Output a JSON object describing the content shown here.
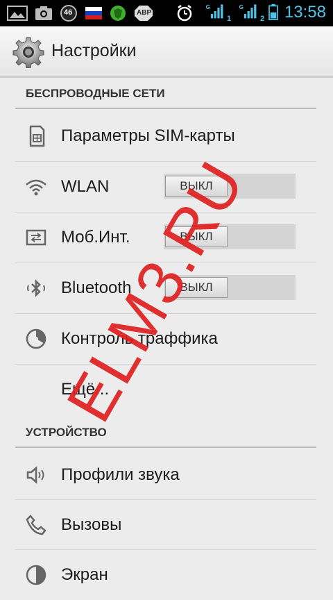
{
  "status_bar": {
    "time": "13:58",
    "network_badge": "46",
    "abp_badge": "ABP",
    "sim1_index": "1",
    "sim2_index": "2",
    "icons": [
      "gallery-icon",
      "camera-icon",
      "network-46-icon",
      "russian-flag-icon",
      "shield-app-icon",
      "abp-icon",
      "alarm-icon",
      "signal-sim1-icon",
      "signal-sim2-icon",
      "battery-icon"
    ]
  },
  "action_bar": {
    "title": "Настройки",
    "icon": "settings-gear-icon"
  },
  "sections": {
    "wireless": {
      "header": "БЕСПРОВОДНЫЕ СЕТИ",
      "items": [
        {
          "label": "Параметры SIM-карты",
          "icon": "sim-card-icon"
        },
        {
          "label": "WLAN",
          "icon": "wifi-icon",
          "toggle": "ВЫКЛ"
        },
        {
          "label": "Моб.Инт.",
          "icon": "data-transfer-icon",
          "toggle": "ВЫКЛ"
        },
        {
          "label": "Bluetooth",
          "icon": "bluetooth-icon",
          "toggle": "ВЫКЛ"
        },
        {
          "label": "Контроль траффика",
          "icon": "data-usage-icon"
        },
        {
          "label": "Ещё..."
        }
      ]
    },
    "device": {
      "header": "УСТРОЙСТВО",
      "items": [
        {
          "label": "Профили звука",
          "icon": "speaker-icon"
        },
        {
          "label": "Вызовы",
          "icon": "phone-icon"
        },
        {
          "label": "Экран",
          "icon": "display-brightness-icon"
        }
      ]
    }
  },
  "watermark": "ELM3.RU",
  "colors": {
    "status_bar": "#000000",
    "time": "#4fc3e8",
    "background": "#ececec",
    "watermark": "#e02020"
  }
}
